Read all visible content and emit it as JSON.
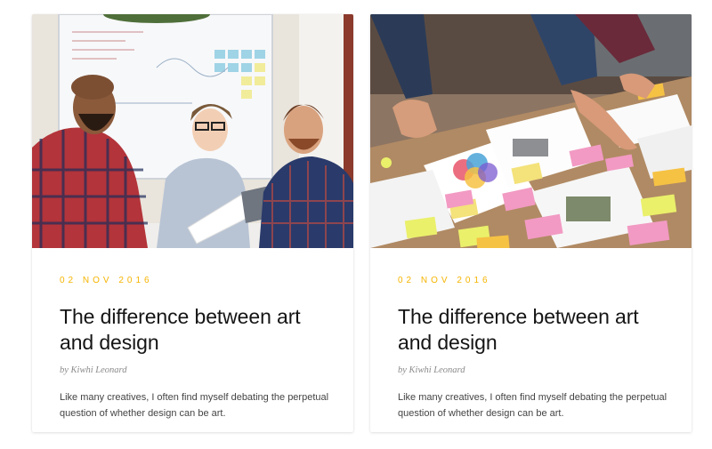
{
  "posts": [
    {
      "image": "team-meeting-photo",
      "date": "02 NOV 2016",
      "title": "The difference between art and design",
      "byline": "by Kiwhi Leonard",
      "excerpt": "Like many creatives, I often find myself debating the perpetual question of whether design can be art."
    },
    {
      "image": "desk-documents-photo",
      "date": "02 NOV 2016",
      "title": "The difference between art and design",
      "byline": "by Kiwhi Leonard",
      "excerpt": "Like many creatives, I often find myself debating the perpetual question of whether design can be art."
    }
  ],
  "colors": {
    "date_accent": "#f5b400",
    "title": "#151515",
    "byline": "#8a8a8a",
    "excerpt": "#444444"
  }
}
